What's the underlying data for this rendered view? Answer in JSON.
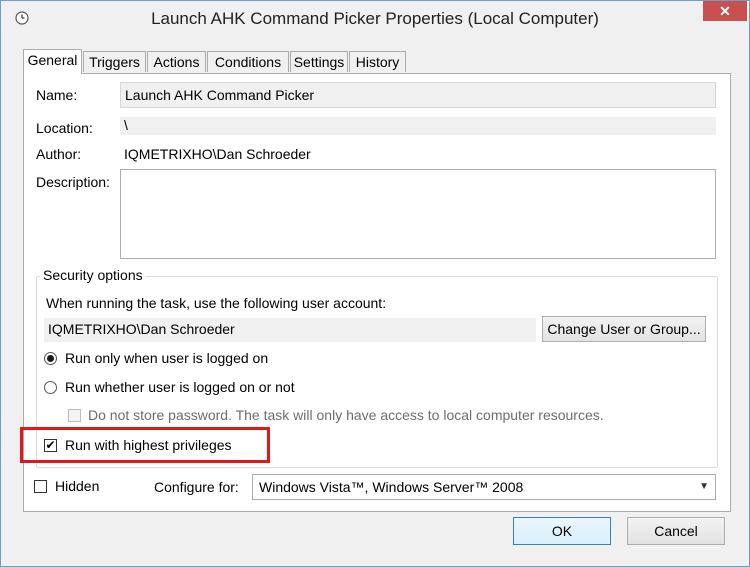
{
  "window": {
    "title": "Launch AHK Command Picker Properties (Local Computer)",
    "close_label": "✕"
  },
  "tabs": [
    {
      "label": "General",
      "active": true
    },
    {
      "label": "Triggers",
      "active": false
    },
    {
      "label": "Actions",
      "active": false
    },
    {
      "label": "Conditions",
      "active": false
    },
    {
      "label": "Settings",
      "active": false
    },
    {
      "label": "History",
      "active": false
    }
  ],
  "general": {
    "name_label": "Name:",
    "name_value": "Launch AHK Command Picker",
    "location_label": "Location:",
    "location_value": "\\",
    "author_label": "Author:",
    "author_value": "IQMETRIXHO\\Dan Schroeder",
    "description_label": "Description:",
    "description_value": ""
  },
  "security": {
    "legend": "Security options",
    "account_prompt": "When running the task, use the following user account:",
    "account_value": "IQMETRIXHO\\Dan Schroeder",
    "change_button": "Change User or Group...",
    "radio_logged_on": "Run only when user is logged on",
    "radio_whether": "Run whether user is logged on or not",
    "selected_radio": "logged_on",
    "no_store_password": "Do not store password.  The task will only have access to local computer resources.",
    "highest_privileges": "Run with highest privileges",
    "highest_privileges_checked": true
  },
  "bottom": {
    "hidden_label": "Hidden",
    "hidden_checked": false,
    "configure_label": "Configure for:",
    "configure_value": "Windows Vista™, Windows Server™ 2008"
  },
  "buttons": {
    "ok": "OK",
    "cancel": "Cancel"
  },
  "colors": {
    "highlight_box": "#e3161b",
    "close_button": "#c75050",
    "default_button_border": "#3c7fb1"
  }
}
